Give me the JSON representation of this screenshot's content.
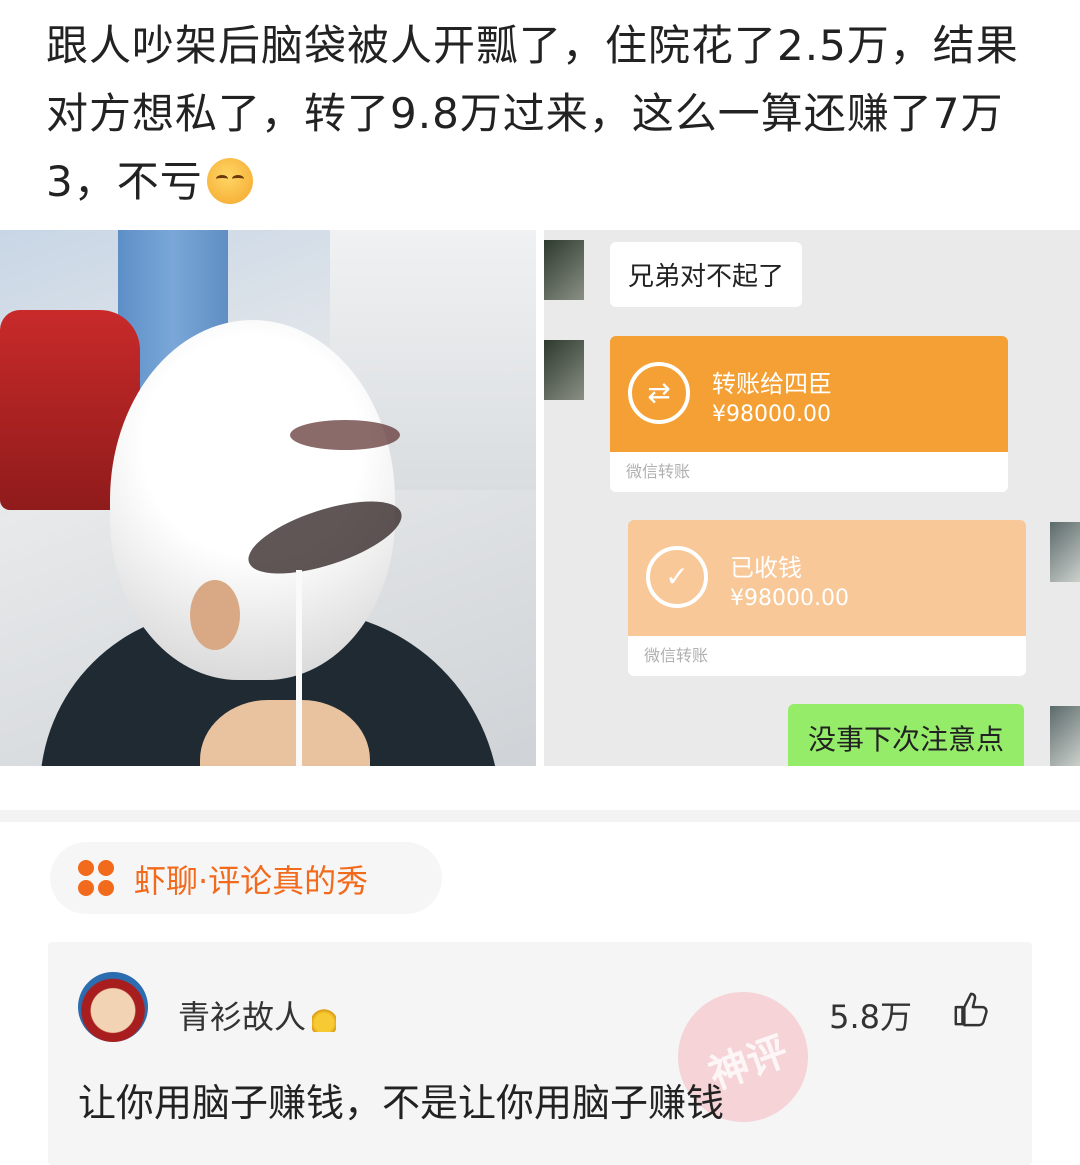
{
  "post": {
    "text": "跟人吵架后脑袋被人开瓢了，住院花了2.5万，结果对方想私了，转了9.8万过来，这么一算还赚了7万3，不亏"
  },
  "chat": {
    "msg1": "兄弟对不起了",
    "transfer": {
      "title": "转账给四臣",
      "amount": "¥98000.00",
      "footer": "微信转账"
    },
    "received": {
      "title": "已收钱",
      "amount": "¥98000.00",
      "footer": "微信转账"
    },
    "reply": "没事下次注意点"
  },
  "tag": {
    "label": "虾聊·评论真的秀"
  },
  "comment": {
    "user": "青衫故人",
    "likes": "5.8万",
    "text": "让你用脑子赚钱，不是让你用脑子赚钱",
    "stamp": "神评"
  },
  "colors": {
    "accent": "#f26b1d",
    "transfer_orange": "#f5a034",
    "received_orange": "#f8c898",
    "wechat_green": "#95ec69"
  }
}
